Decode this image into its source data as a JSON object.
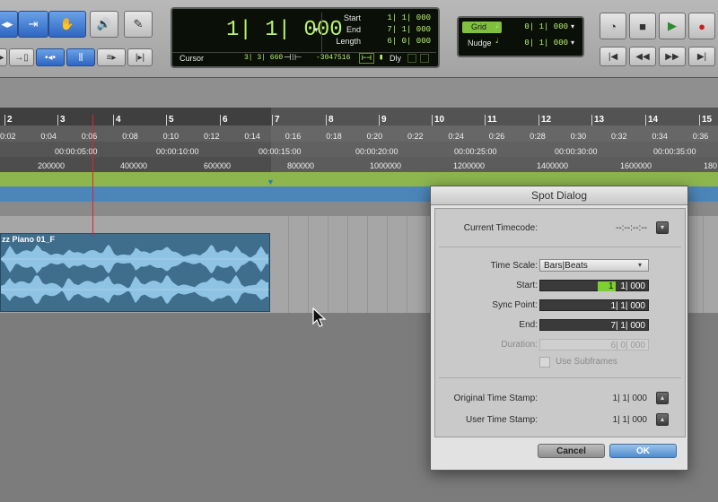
{
  "counter": {
    "main": "1| 1| 000",
    "start_label": "Start",
    "start_value": "1| 1| 000",
    "end_label": "End",
    "end_value": "7| 1| 000",
    "length_label": "Length",
    "length_value": "6| 0| 000",
    "cursor_label": "Cursor",
    "cursor_value": "3| 3| 660",
    "sample_value": "-3047516",
    "dly_label": "Dly"
  },
  "grid": {
    "grid_label": "Grid",
    "grid_value": "0| 1| 000",
    "nudge_label": "Nudge",
    "nudge_value": "0| 1| 000"
  },
  "bars": [
    "2",
    "3",
    "4",
    "5",
    "6",
    "7",
    "8",
    "9",
    "10",
    "11",
    "12",
    "13",
    "14",
    "15"
  ],
  "minsecs": [
    "0:02",
    "0:04",
    "0:06",
    "0:08",
    "0:10",
    "0:12",
    "0:14",
    "0:16",
    "0:18",
    "0:20",
    "0:22",
    "0:24",
    "0:26",
    "0:28",
    "0:30",
    "0:32",
    "0:34",
    "0:36"
  ],
  "timecodes": [
    "00:00:05:00",
    "00:00:10:00",
    "00:00:15:00",
    "00:00:20:00",
    "00:00:25:00",
    "00:00:30:00",
    "00:00:35:00"
  ],
  "samples": [
    "200000",
    "400000",
    "600000",
    "800000",
    "1000000",
    "1200000",
    "1400000",
    "1600000",
    "180"
  ],
  "clip": {
    "title": "zz Piano 01_F"
  },
  "dialog": {
    "title": "Spot Dialog",
    "current_timecode_label": "Current Timecode:",
    "current_timecode_value": "--:--:--:--",
    "time_scale_label": "Time Scale:",
    "time_scale_value": "Bars|Beats",
    "start_label": "Start:",
    "start_value_a": "1",
    "start_value_b": "1| 000",
    "sync_label": "Sync Point:",
    "sync_value": "1| 1| 000",
    "end_label": "End:",
    "end_value": "7| 1| 000",
    "duration_label": "Duration:",
    "duration_value": "6| 0| 000",
    "subframes_label": "Use Subframes",
    "orig_stamp_label": "Original Time Stamp:",
    "orig_stamp_value": "1| 1| 000",
    "user_stamp_label": "User Time Stamp:",
    "user_stamp_value": "1| 1| 000",
    "cancel_label": "Cancel",
    "ok_label": "OK"
  }
}
